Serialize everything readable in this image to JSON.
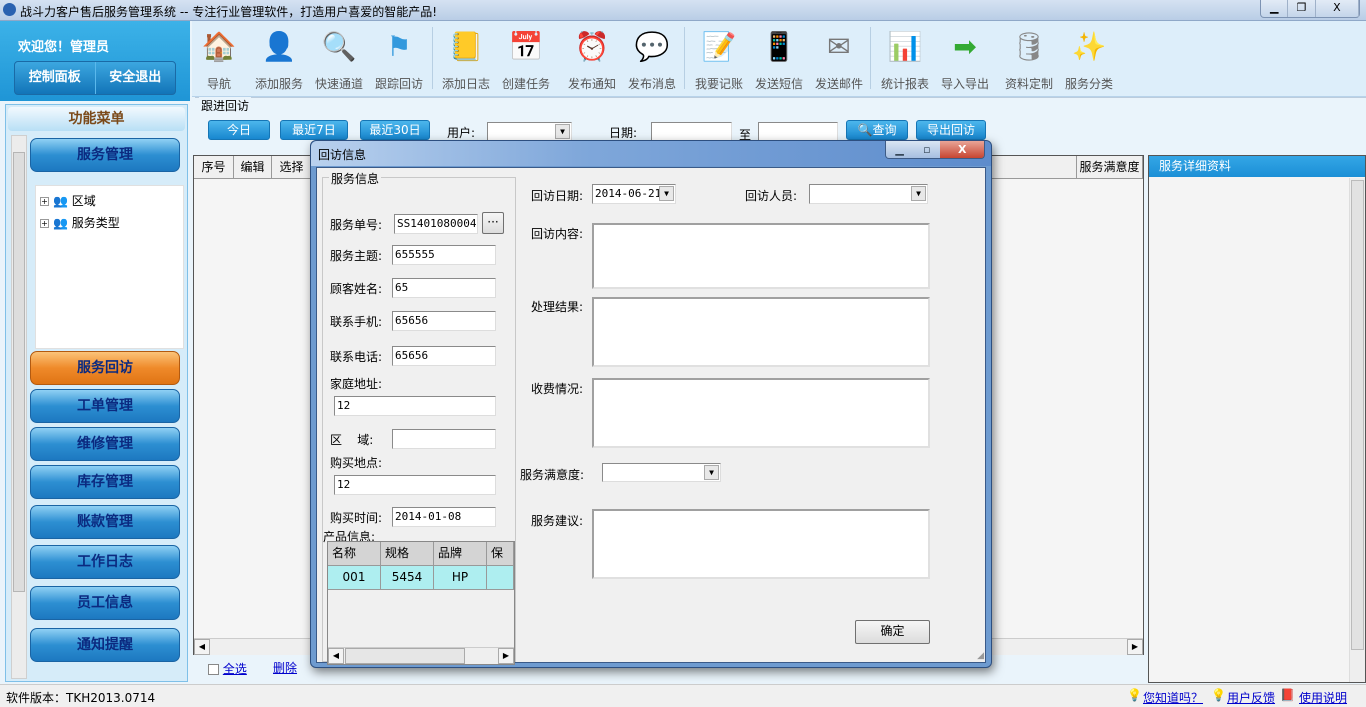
{
  "window": {
    "title": "战斗力客户售后服务管理系统 -- 专注行业管理软件，打造用户喜爱的智能产品!",
    "controls": [
      "▁",
      "❐",
      "X"
    ]
  },
  "header": {
    "welcome": "欢迎您！管理员",
    "control_panel": "控制面板",
    "logout": "安全退出"
  },
  "toolbar": [
    {
      "label": "导航",
      "icon": "home-icon",
      "glyph": "🏠"
    },
    {
      "label": "添加服务",
      "icon": "user-add-icon",
      "glyph": "👤"
    },
    {
      "label": "快速通道",
      "icon": "search-doc-icon",
      "glyph": "🔍"
    },
    {
      "label": "跟踪回访",
      "icon": "flag-icon",
      "glyph": "⚑"
    },
    {
      "label": "添加日志",
      "icon": "notepad-icon",
      "glyph": "📒"
    },
    {
      "label": "创建任务",
      "icon": "calendar-icon",
      "glyph": "📅"
    },
    {
      "label": "发布通知",
      "icon": "alarm-clock-icon",
      "glyph": "⏰"
    },
    {
      "label": "发布消息",
      "icon": "speech-bubble-icon",
      "glyph": "💬"
    },
    {
      "label": "我要记账",
      "icon": "notebook-pen-icon",
      "glyph": "📝"
    },
    {
      "label": "发送短信",
      "icon": "phone-icon",
      "glyph": "📱"
    },
    {
      "label": "发送邮件",
      "icon": "envelope-icon",
      "glyph": "✉"
    },
    {
      "label": "统计报表",
      "icon": "chart-icon",
      "glyph": "📊"
    },
    {
      "label": "导入导出",
      "icon": "import-export-icon",
      "glyph": "➡"
    },
    {
      "label": "资料定制",
      "icon": "database-icon",
      "glyph": "🛢"
    },
    {
      "label": "服务分类",
      "icon": "magic-wand-icon",
      "glyph": "✨"
    }
  ],
  "menu": {
    "title": "功能菜单",
    "service_mgmt": "服务管理",
    "tree": [
      "区域",
      "服务类型"
    ],
    "items": [
      "服务回访",
      "工单管理",
      "维修管理",
      "库存管理",
      "账款管理",
      "工作日志",
      "员工信息",
      "通知提醒"
    ]
  },
  "filter": {
    "group": "跟进回访",
    "today": "今日",
    "last7": "最近7日",
    "last30": "最近30日",
    "user_label": "用户:",
    "user_value": "",
    "date_label": "日期:",
    "date_from": "",
    "to": "至",
    "date_to": "",
    "search": "查询",
    "export": "导出回访"
  },
  "grid": {
    "columns": [
      "序号",
      "编辑",
      "选择"
    ],
    "last_column": "服务满意度",
    "select_all": "全选",
    "delete": "删除"
  },
  "detail": {
    "title": "服务详细资料"
  },
  "status": {
    "version": "软件版本：TKH2013.0714",
    "tips": "您知道吗？",
    "feedback": "用户反馈",
    "help": "使用说明"
  },
  "dialog": {
    "title": "回访信息",
    "group": "服务信息",
    "fields": {
      "service_no_label": "服务单号:",
      "service_no": "SS1401080004",
      "more": "···",
      "subject_label": "服务主题:",
      "subject": "655555",
      "customer_label": "顾客姓名:",
      "customer": "65",
      "mobile_label": "联系手机:",
      "mobile": "65656",
      "phone_label": "联系电话:",
      "phone": "65656",
      "address_label": "家庭地址:",
      "address": "12",
      "region_label": "区    域:",
      "region": "",
      "buy_place_label": "购买地点:",
      "buy_place": "12",
      "buy_time_label": "购买时间:",
      "buy_time": "2014-01-08",
      "product_label": "产品信息:"
    },
    "products": {
      "columns": [
        "名称",
        "规格",
        "品牌",
        "保修"
      ],
      "rows": [
        [
          "001",
          "5454",
          "HP",
          ""
        ]
      ]
    },
    "visit_date_label": "回访日期:",
    "visit_date": "2014-06-21",
    "visitor_label": "回访人员:",
    "visitor": "",
    "content_label": "回访内容:",
    "result_label": "处理结果:",
    "fee_label": "收费情况:",
    "satisfaction_label": "服务满意度:",
    "satisfaction": "",
    "suggestion_label": "服务建议:",
    "ok": "确定"
  }
}
